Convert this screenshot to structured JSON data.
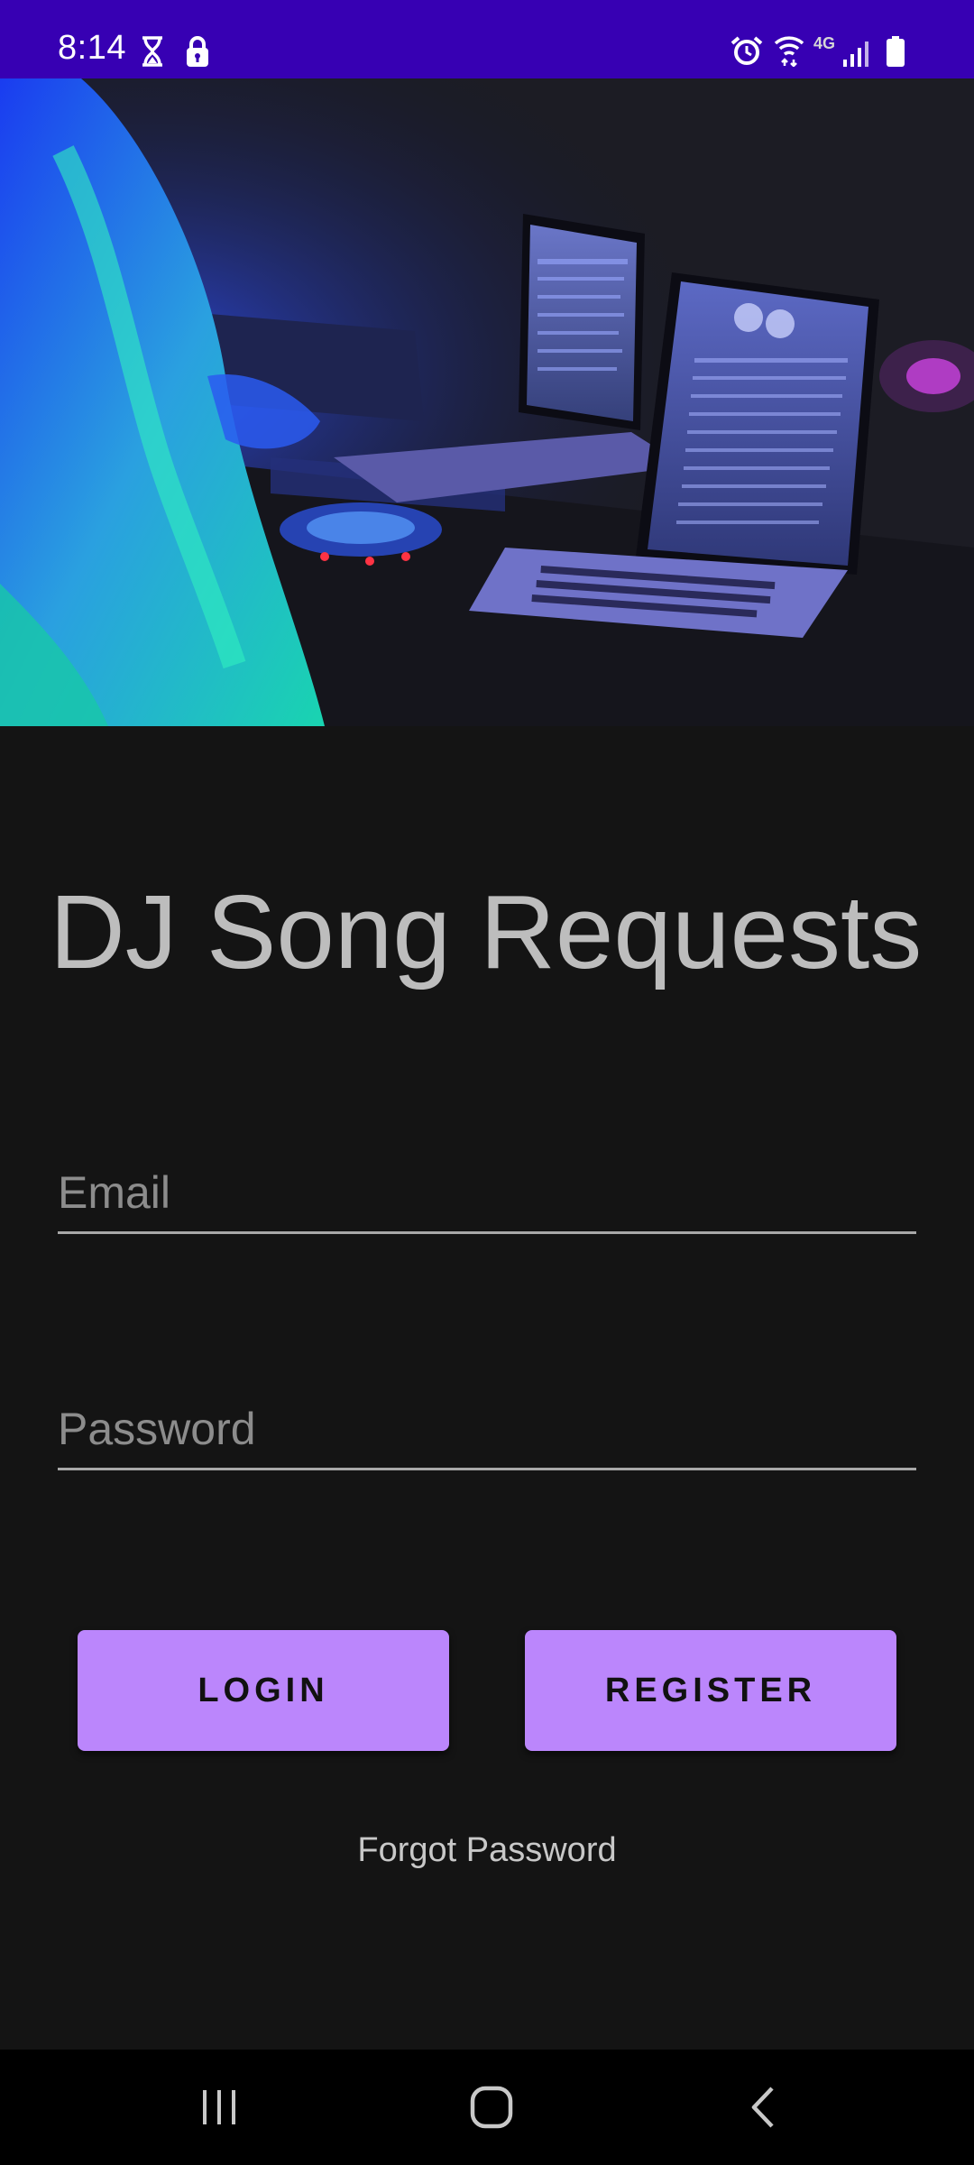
{
  "status_bar": {
    "time": "8:14",
    "network_label": "4G",
    "left_icons": [
      "hourglass-icon",
      "lock-icon"
    ],
    "right_icons": [
      "alarm-icon",
      "wifi-icon",
      "signal-icon",
      "battery-icon"
    ],
    "background_color": "#3700b3"
  },
  "hero": {
    "image_description_icon": "dj-laptops-photo"
  },
  "app": {
    "title": "DJ Song Requests"
  },
  "form": {
    "email_placeholder": "Email",
    "email_value": "",
    "password_placeholder": "Password",
    "password_value": ""
  },
  "buttons": {
    "login_label": "LOGIN",
    "register_label": "REGISTER",
    "accent_color": "#bb86fc"
  },
  "links": {
    "forgot_password": "Forgot Password"
  },
  "nav_bar": {
    "items": [
      "recent-apps-icon",
      "home-icon",
      "back-icon"
    ]
  }
}
